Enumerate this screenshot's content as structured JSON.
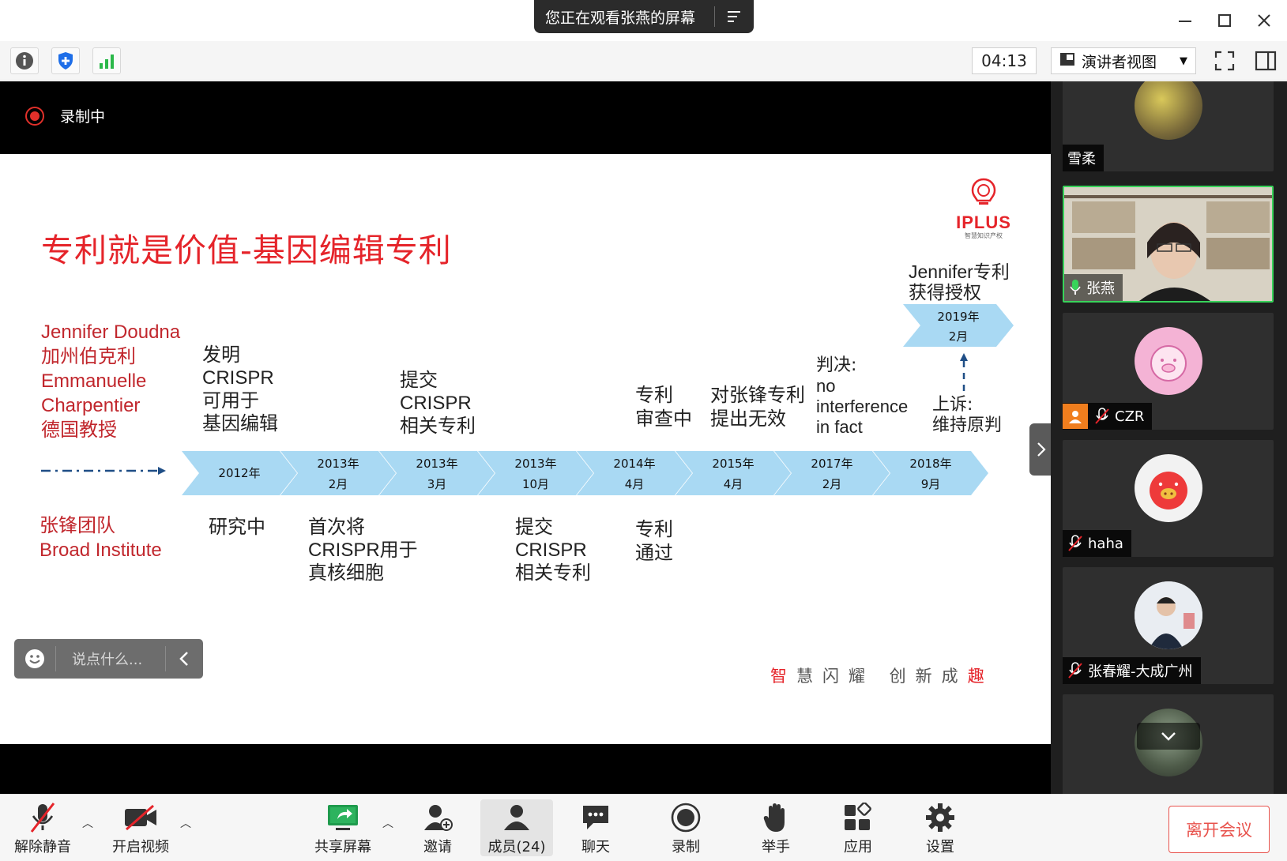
{
  "window": {
    "share_banner": "您正在观看张燕的屏幕"
  },
  "toolbar": {
    "timer": "04:13",
    "view_mode": "演讲者视图"
  },
  "recording": {
    "label": "录制中"
  },
  "slide": {
    "title": "专利就是价值-基因编辑专利",
    "logo_text": "IPLUS",
    "logo_sub": "智慧知识产权",
    "top_party": [
      "Jennifer Doudna",
      "加州伯克利",
      "Emmanuelle",
      "Charpentier",
      "德国教授"
    ],
    "bottom_party": [
      "张锋团队",
      "Broad Institute"
    ],
    "timeline": [
      {
        "year": "2012年",
        "month": ""
      },
      {
        "year": "2013年",
        "month": "2月"
      },
      {
        "year": "2013年",
        "month": "3月"
      },
      {
        "year": "2013年",
        "month": "10月"
      },
      {
        "year": "2014年",
        "month": "4月"
      },
      {
        "year": "2015年",
        "month": "4月"
      },
      {
        "year": "2017年",
        "month": "2月"
      },
      {
        "year": "2018年",
        "month": "9月"
      }
    ],
    "final_event": {
      "year": "2019年",
      "month": "2月"
    },
    "final_caption": [
      "Jennifer专利",
      "获得授权"
    ],
    "above": {
      "e0": [
        "发明",
        "CRISPR",
        "可用于",
        "基因编辑"
      ],
      "e2": [
        "提交",
        "CRISPR",
        "相关专利"
      ],
      "e4": [
        "专利",
        "审查中"
      ],
      "e5": [
        "对张锋专利",
        "提出无效"
      ],
      "e6": [
        "判决:",
        "no",
        "interference",
        "in fact"
      ],
      "e7": [
        "上诉:",
        "维持原判"
      ]
    },
    "below": {
      "e0": [
        "研究中"
      ],
      "e1": [
        "首次将",
        "CRISPR用于",
        "真核细胞"
      ],
      "e3": [
        "提交",
        "CRISPR",
        "相关专利"
      ],
      "e4": [
        "专利",
        "通过"
      ]
    },
    "slogan_a": "智",
    "slogan_b": "慧闪耀 创新成",
    "slogan_c": "趣"
  },
  "chat": {
    "placeholder": "说点什么..."
  },
  "participants": [
    {
      "name": "雪柔",
      "active": false
    },
    {
      "name": "张燕",
      "active": true
    },
    {
      "name": "CZR",
      "active": false
    },
    {
      "name": "haha",
      "active": false
    },
    {
      "name": "张春耀-大成广州",
      "active": false
    }
  ],
  "controls": {
    "unmute": "解除静音",
    "video": "开启视频",
    "share": "共享屏幕",
    "invite": "邀请",
    "members": "成员(24)",
    "chat": "聊天",
    "record": "录制",
    "raise_hand": "举手",
    "apps": "应用",
    "settings": "设置",
    "leave": "离开会议"
  },
  "colors": {
    "accent_red": "#e5242a",
    "chevron_blue": "#a9d9f3",
    "active_green": "#38d35a"
  }
}
